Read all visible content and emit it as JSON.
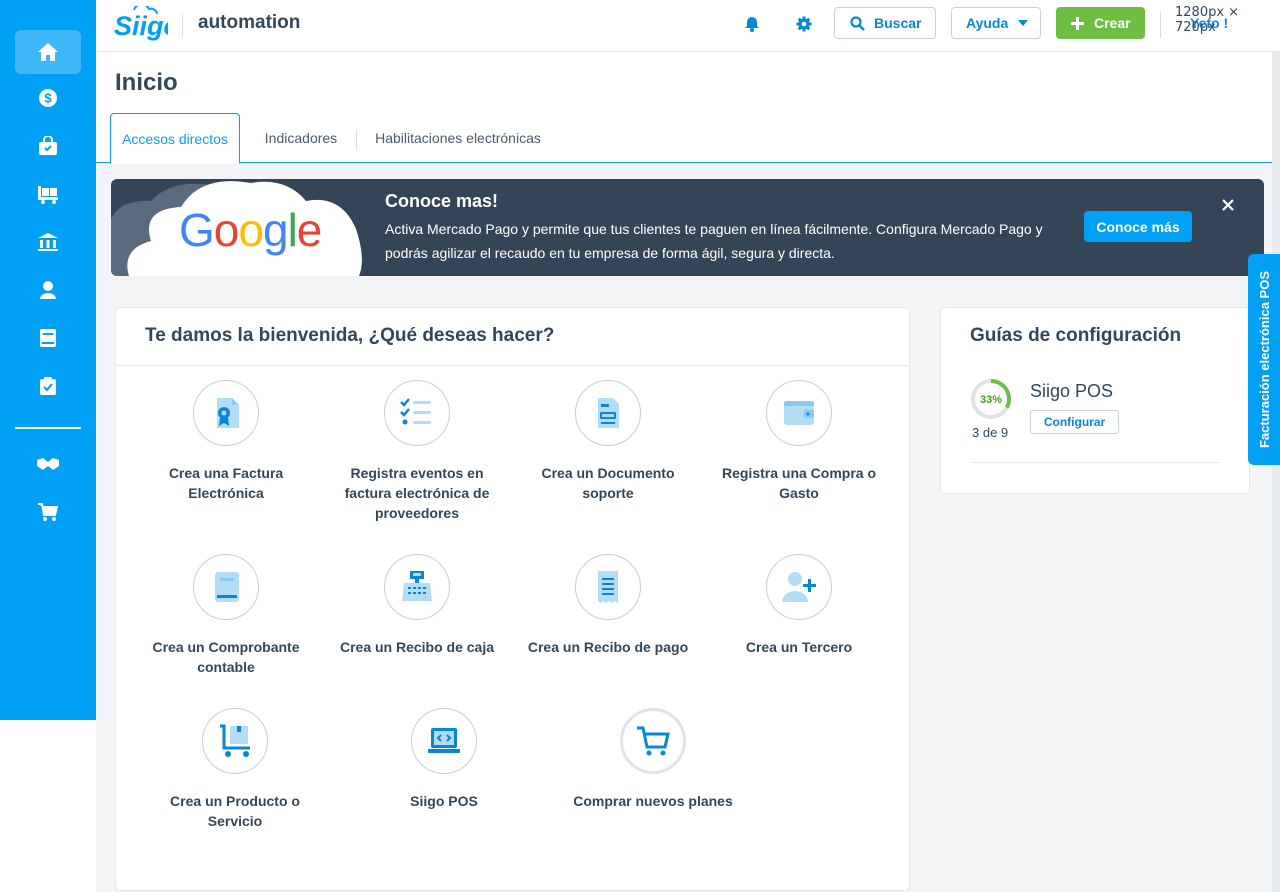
{
  "header": {
    "company": "automation",
    "search_label": "Buscar",
    "help_label": "Ayuda",
    "create_label": "Crear",
    "user_label": "Yeto !",
    "size_label": "1280px × 720px"
  },
  "page": {
    "title": "Inicio",
    "tabs": [
      "Accesos directos",
      "Indicadores",
      "Habilitaciones electrónicas"
    ]
  },
  "banner": {
    "title": "Conoce mas!",
    "text": "Activa Mercado Pago y permite que tus clientes te paguen en línea fácilmente. Configura Mercado Pago y podrás agilizar el recaudo en tu empresa de forma ágil, segura y directa.",
    "button": "Conoce más",
    "logo_text": "Google"
  },
  "welcome": {
    "title": "Te damos la bienvenida, ¿Qué deseas hacer?",
    "actions": [
      {
        "label": "Crea una Factura Electrónica",
        "icon": "invoice-icon"
      },
      {
        "label": "Registra eventos en factura electrónica de proveedores",
        "icon": "checklist-icon"
      },
      {
        "label": "Crea un Documento soporte",
        "icon": "support-document-icon"
      },
      {
        "label": "Registra una Compra o Gasto",
        "icon": "wallet-icon"
      },
      {
        "label": "Crea un Comprobante contable",
        "icon": "accounting-voucher-icon"
      },
      {
        "label": "Crea un Recibo de caja",
        "icon": "cash-register-icon"
      },
      {
        "label": "Crea un Recibo de pago",
        "icon": "receipt-icon"
      },
      {
        "label": "Crea un Tercero",
        "icon": "add-person-icon"
      },
      {
        "label": "Crea un Producto o Servicio",
        "icon": "product-cart-icon"
      },
      {
        "label": "Siigo POS",
        "icon": "pos-laptop-icon"
      },
      {
        "label": "Comprar nuevos planes",
        "icon": "shopping-cart-icon"
      }
    ]
  },
  "guides": {
    "title": "Guías de configuración",
    "items": [
      {
        "name": "Siigo POS",
        "progress_text": "33%",
        "progress": 0.33,
        "count": "3 de 9",
        "button": "Configurar"
      }
    ]
  },
  "side_tab": "Facturación electrónica POS",
  "colors": {
    "brand": "#00a0f5",
    "banner_bg": "#354558",
    "create_green": "#6fbe44",
    "progress_green": "#6fbe44"
  }
}
